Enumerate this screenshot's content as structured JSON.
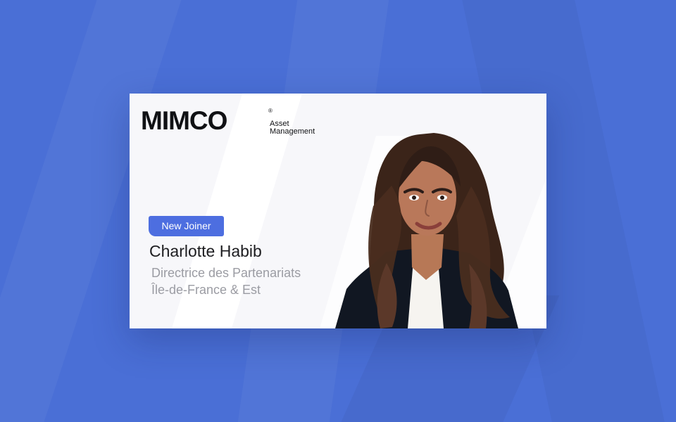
{
  "brand": {
    "name": "MIMCO",
    "registered_mark": "®",
    "subtitle_line1": "Asset",
    "subtitle_line2": "Management"
  },
  "card": {
    "badge": "New Joiner",
    "name": "Charlotte Habib",
    "role_line1": "Directrice des Partenariats",
    "role_line2": "Île-de-France & Est"
  },
  "colors": {
    "background": "#4a6fd6",
    "card": "#f7f7fa",
    "badge": "#4d6ee0",
    "text_primary": "#1d1d20",
    "text_secondary": "#9b9ca3"
  },
  "icons": {
    "portrait": "woman-portrait"
  }
}
